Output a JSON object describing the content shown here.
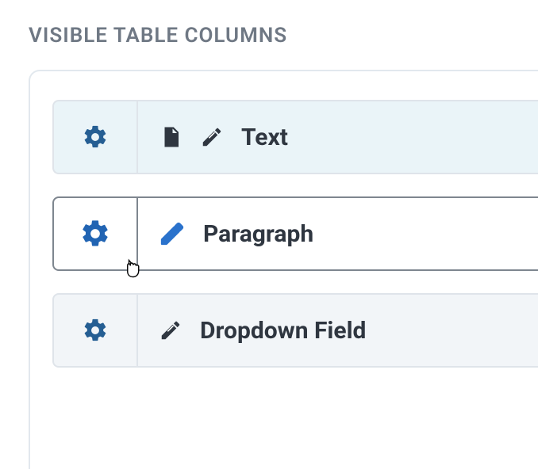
{
  "section": {
    "title": "VISIBLE TABLE COLUMNS"
  },
  "columns": [
    {
      "label": "Text"
    },
    {
      "label": "Paragraph"
    },
    {
      "label": "Dropdown Field"
    }
  ]
}
